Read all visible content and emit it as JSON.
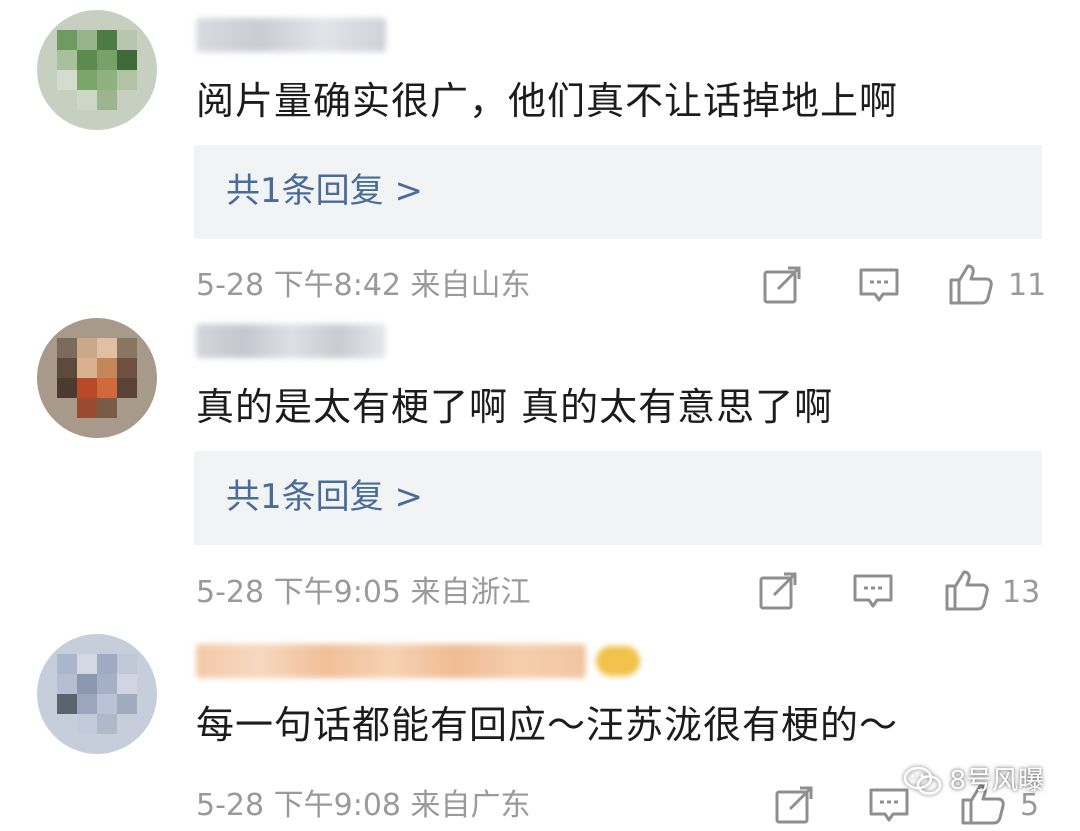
{
  "colors": {
    "link": "#4a6c98",
    "meta": "#9a9a9a",
    "reply_bg": "#f2f3f5",
    "text": "#1c1c1c"
  },
  "comments": [
    {
      "text": "阅片量确实很广，他们真不让话掉地上啊",
      "replies_label": "共1条回复 >",
      "meta": "5-28 下午8:42 来自山东",
      "likes": "11"
    },
    {
      "text": "真的是太有梗了啊 真的太有意思了啊",
      "replies_label": "共1条回复 >",
      "meta": "5-28 下午9:05 来自浙江",
      "likes": "13"
    },
    {
      "text": "每一句话都能有回应～汪苏泷很有梗的～",
      "meta": "5-28 下午9:08 来自广东",
      "likes": "5"
    }
  ],
  "icons": {
    "share": "share-icon",
    "comment": "comment-icon",
    "like": "thumbs-up-icon",
    "watermark": "wechat-icon"
  },
  "watermark": {
    "text": "8号风曝"
  }
}
